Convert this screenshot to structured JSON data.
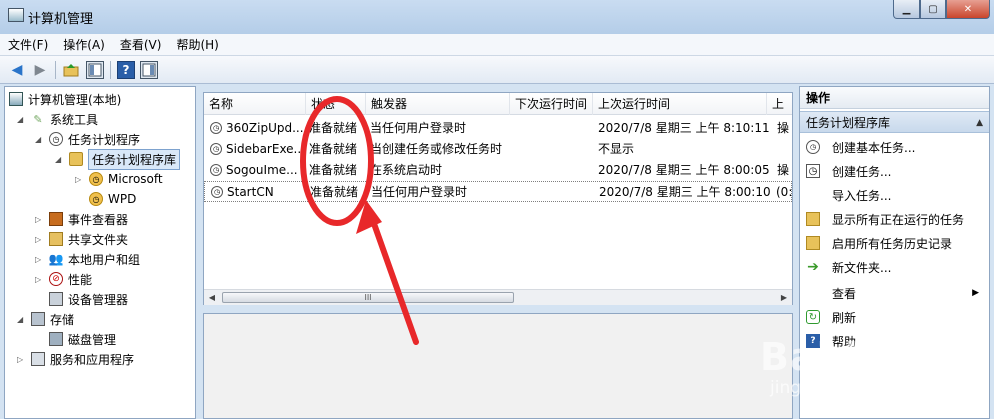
{
  "window": {
    "title": "计算机管理"
  },
  "menu": [
    "文件(F)",
    "操作(A)",
    "查看(V)",
    "帮助(H)"
  ],
  "tree": {
    "root": "计算机管理(本地)",
    "system_tools": "系统工具",
    "task_scheduler": "任务计划程序",
    "task_library": "任务计划程序库",
    "microsoft": "Microsoft",
    "wpd": "WPD",
    "event_viewer": "事件查看器",
    "shared_folders": "共享文件夹",
    "local_users": "本地用户和组",
    "performance": "性能",
    "device_manager": "设备管理器",
    "storage": "存储",
    "disk_management": "磁盘管理",
    "services_apps": "服务和应用程序"
  },
  "table": {
    "columns": [
      "名称",
      "状态",
      "触发器",
      "下次运行时间",
      "上次运行时间",
      "上"
    ],
    "rows": [
      {
        "name": "360ZipUpd...",
        "status": "准备就绪",
        "trigger": "当任何用户登录时",
        "next": "",
        "last": "2020/7/8 星期三 上午 8:10:11",
        "extra": "操"
      },
      {
        "name": "SidebarExe...",
        "status": "准备就绪",
        "trigger": "当创建任务或修改任务时",
        "next": "",
        "last": "不显示",
        "extra": ""
      },
      {
        "name": "SogouIme...",
        "status": "准备就绪",
        "trigger": "在系统启动时",
        "next": "",
        "last": "2020/7/8 星期三 上午 8:00:05",
        "extra": "操"
      },
      {
        "name": "StartCN",
        "status": "准备就绪",
        "trigger": "当任何用户登录时",
        "next": "",
        "last": "2020/7/8 星期三 上午 8:00:10",
        "extra": "(0:"
      }
    ],
    "scroll_thumb": "III"
  },
  "actions": {
    "header": "操作",
    "section": "任务计划程序库",
    "items": [
      "创建基本任务...",
      "创建任务...",
      "导入任务...",
      "显示所有正在运行的任务",
      "启用所有任务历史记录",
      "新文件夹...",
      "查看",
      "刷新",
      "帮助"
    ]
  },
  "annotation": {
    "color": "#e8282a"
  },
  "watermark": {
    "main": "Baidu 经验",
    "sub": "jingyan.baidu.com"
  }
}
